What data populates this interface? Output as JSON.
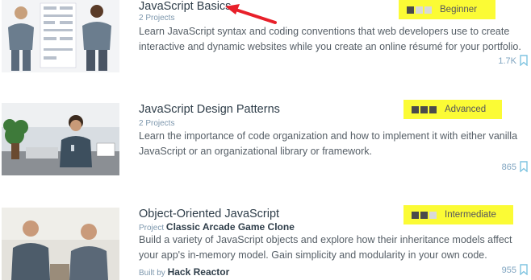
{
  "courses": [
    {
      "title": "JavaScript Basics",
      "meta": "2 Projects",
      "description": "Learn JavaScript syntax and coding conventions that web developers use to create interactive and dynamic websites while you create an online résumé for your portfolio.",
      "level": "Beginner",
      "level_value": 1,
      "count": "1.7K"
    },
    {
      "title": "JavaScript Design Patterns",
      "meta": "2 Projects",
      "description": "Learn the importance of code organization and how to implement it with either vanilla JavaScript or an organizational library or framework.",
      "level": "Advanced",
      "level_value": 3,
      "count": "865"
    },
    {
      "title": "Object-Oriented JavaScript",
      "project_prefix": "Project",
      "project_name": "Classic Arcade Game Clone",
      "description": "Build a variety of JavaScript objects and explore how their inheritance models affect your app's in-memory model. Gain simplicity and modularity in your own code.",
      "level": "Intermediate",
      "level_value": 2,
      "builtby_prefix": "Built by",
      "builtby_name": "Hack Reactor",
      "count": "955"
    }
  ],
  "colors": {
    "highlight": "#fbfb35",
    "arrow": "#e8202a",
    "bookmark": "#7fc4e0",
    "bar_on": "#4b4b4b",
    "bar_off": "#d9d9d9"
  },
  "icons": [
    "bookmark-icon",
    "red-arrow-annotation"
  ]
}
